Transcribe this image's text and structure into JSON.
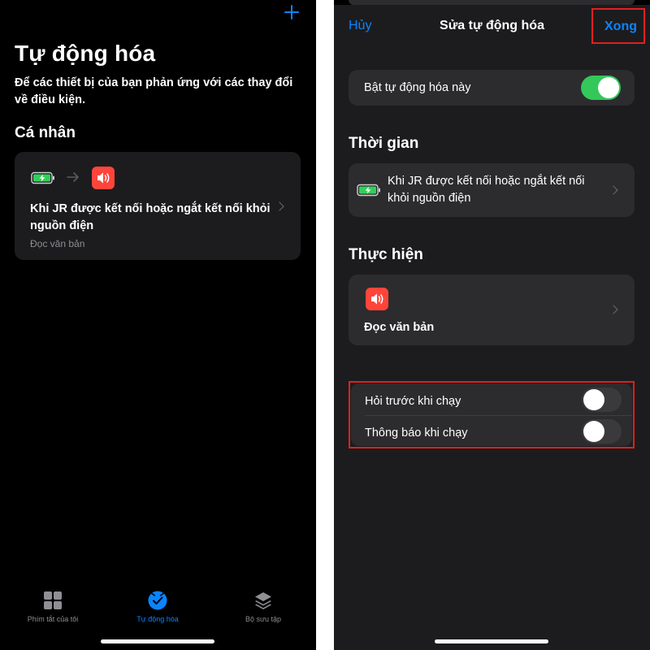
{
  "left": {
    "add_glyph": "+",
    "title": "Tự động hóa",
    "description": "Để các thiết bị của bạn phản ứng với các thay đổi về điều kiện.",
    "section": "Cá nhân",
    "card": {
      "title": "Khi JR được kết nối hoặc ngắt kết nối khỏi nguồn điện",
      "subtitle": "Đọc văn bản"
    },
    "tabs": [
      {
        "label": "Phím tắt của tôi",
        "icon": "grid-icon",
        "active": false
      },
      {
        "label": "Tự động hóa",
        "icon": "clock-check-icon",
        "active": true
      },
      {
        "label": "Bộ sưu tập",
        "icon": "layers-icon",
        "active": false
      }
    ]
  },
  "right": {
    "nav": {
      "cancel": "Hủy",
      "title": "Sửa tự động hóa",
      "done": "Xong"
    },
    "enable": {
      "label": "Bật tự động hóa này",
      "on": true
    },
    "time_section": "Thời gian",
    "trigger_text": "Khi JR được kết nối hoặc ngắt kết nối khỏi nguồn điện",
    "action_section": "Thực hiện",
    "action_label": "Đọc văn bản",
    "options": [
      {
        "label": "Hỏi trước khi chạy",
        "on": false
      },
      {
        "label": "Thông báo khi chạy",
        "on": false
      }
    ]
  },
  "colors": {
    "accent": "#0a84ff",
    "toggle_on": "#34c759",
    "toggle_off": "#3a3a3c",
    "action_red": "#ff453a",
    "highlight_border": "#e02020",
    "battery_green": "#30d158"
  }
}
